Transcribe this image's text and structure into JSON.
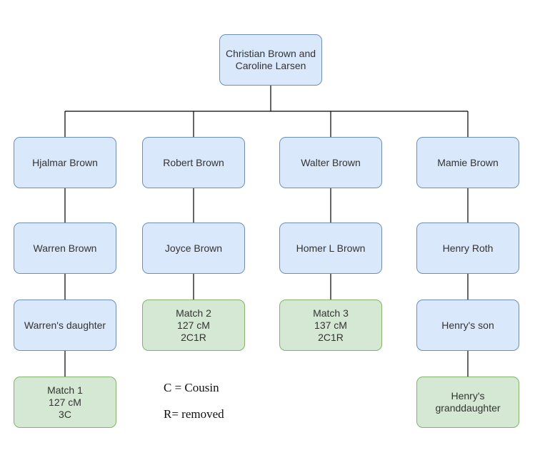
{
  "diagram": {
    "root": {
      "id": "root",
      "label": "Christian Brown and\nCaroline Larsen",
      "type": "person"
    },
    "columns": [
      {
        "branch": "hjalmar",
        "nodes": [
          {
            "id": "hjalmar-brown",
            "label": "Hjalmar Brown",
            "type": "person"
          },
          {
            "id": "warren-brown",
            "label": "Warren Brown",
            "type": "person"
          },
          {
            "id": "warrens-daughter",
            "label": "Warren's daughter",
            "type": "person"
          },
          {
            "id": "match-1",
            "label": "Match 1\n127 cM\n3C",
            "type": "match"
          }
        ]
      },
      {
        "branch": "robert",
        "nodes": [
          {
            "id": "robert-brown",
            "label": "Robert Brown",
            "type": "person"
          },
          {
            "id": "joyce-brown",
            "label": "Joyce Brown",
            "type": "person"
          },
          {
            "id": "match-2",
            "label": "Match 2\n127 cM\n2C1R",
            "type": "match"
          }
        ]
      },
      {
        "branch": "walter",
        "nodes": [
          {
            "id": "walter-brown",
            "label": "Walter Brown",
            "type": "person"
          },
          {
            "id": "homer-l-brown",
            "label": "Homer L Brown",
            "type": "person"
          },
          {
            "id": "match-3",
            "label": "Match 3\n137 cM\n2C1R",
            "type": "match"
          }
        ]
      },
      {
        "branch": "mamie",
        "nodes": [
          {
            "id": "mamie-brown",
            "label": "Mamie Brown",
            "type": "person"
          },
          {
            "id": "henry-roth",
            "label": "Henry Roth",
            "type": "person"
          },
          {
            "id": "henrys-son",
            "label": "Henry's son",
            "type": "person"
          },
          {
            "id": "henrys-granddaughter",
            "label": "Henry's\ngranddaughter",
            "type": "match"
          }
        ]
      }
    ],
    "legend": [
      {
        "text": "C = Cousin"
      },
      {
        "text": "R= removed"
      }
    ],
    "colors": {
      "person_fill": "#dae8fc",
      "person_stroke": "#6c8ebf",
      "match_fill": "#d5e8d4",
      "match_stroke": "#82b366",
      "connector": "#000000"
    }
  }
}
